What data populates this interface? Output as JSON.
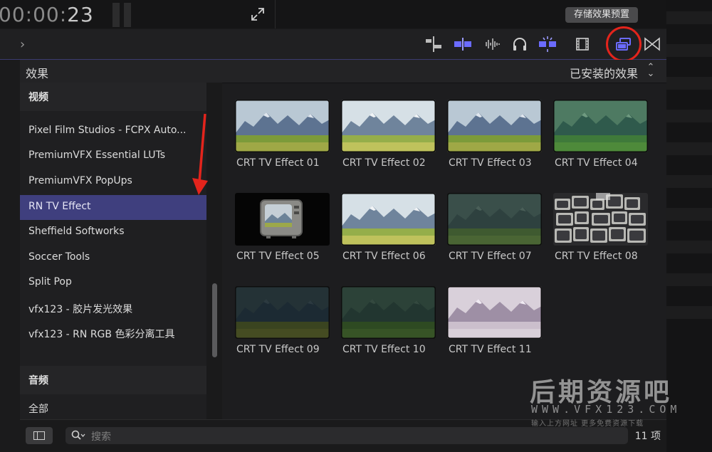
{
  "top": {
    "timecode_dim": "00:00:",
    "timecode_bright": "23",
    "save_preset_label": "存储效果预置"
  },
  "sidebar": {
    "header": "效果",
    "video_group": "视频",
    "items": [
      {
        "label": "Pixel Film Studios - FCPX Auto..."
      },
      {
        "label": "PremiumVFX Essential LUTs"
      },
      {
        "label": "PremiumVFX PopUps"
      },
      {
        "label": "RN TV Effect",
        "selected": true
      },
      {
        "label": "Sheffield Softworks"
      },
      {
        "label": "Soccer Tools"
      },
      {
        "label": "Split Pop"
      },
      {
        "label": "vfx123 - 胶片发光效果"
      },
      {
        "label": "vfx123 - RN RGB 色彩分离工具"
      }
    ],
    "audio_group": "音频",
    "all_group": "全部"
  },
  "browser": {
    "filter_label": "已安装的效果",
    "effects": [
      {
        "label": "CRT TV Effect 01",
        "style": "normal"
      },
      {
        "label": "CRT TV Effect 02",
        "style": "bright"
      },
      {
        "label": "CRT TV Effect 03",
        "style": "normal"
      },
      {
        "label": "CRT TV Effect 04",
        "style": "green"
      },
      {
        "label": "CRT TV Effect 05",
        "style": "tvset"
      },
      {
        "label": "CRT TV Effect 06",
        "style": "bright"
      },
      {
        "label": "CRT TV Effect 07",
        "style": "dimgreen"
      },
      {
        "label": "CRT TV Effect 08",
        "style": "tvwall"
      },
      {
        "label": "CRT TV Effect 09",
        "style": "dark"
      },
      {
        "label": "CRT TV Effect 10",
        "style": "darkgreen"
      },
      {
        "label": "CRT TV Effect 11",
        "style": "pink"
      }
    ]
  },
  "bottom": {
    "search_placeholder": "搜索",
    "item_count": "11 项"
  },
  "watermark": {
    "title": "后期资源吧",
    "url": "WWW.VFX123.COM",
    "subtitle": "输入上方网址 更多免费资源下载"
  },
  "colors": {
    "selection": "#3f3f7e",
    "accent_icon": "#6b6bff",
    "highlight_ring": "#e3241c"
  }
}
